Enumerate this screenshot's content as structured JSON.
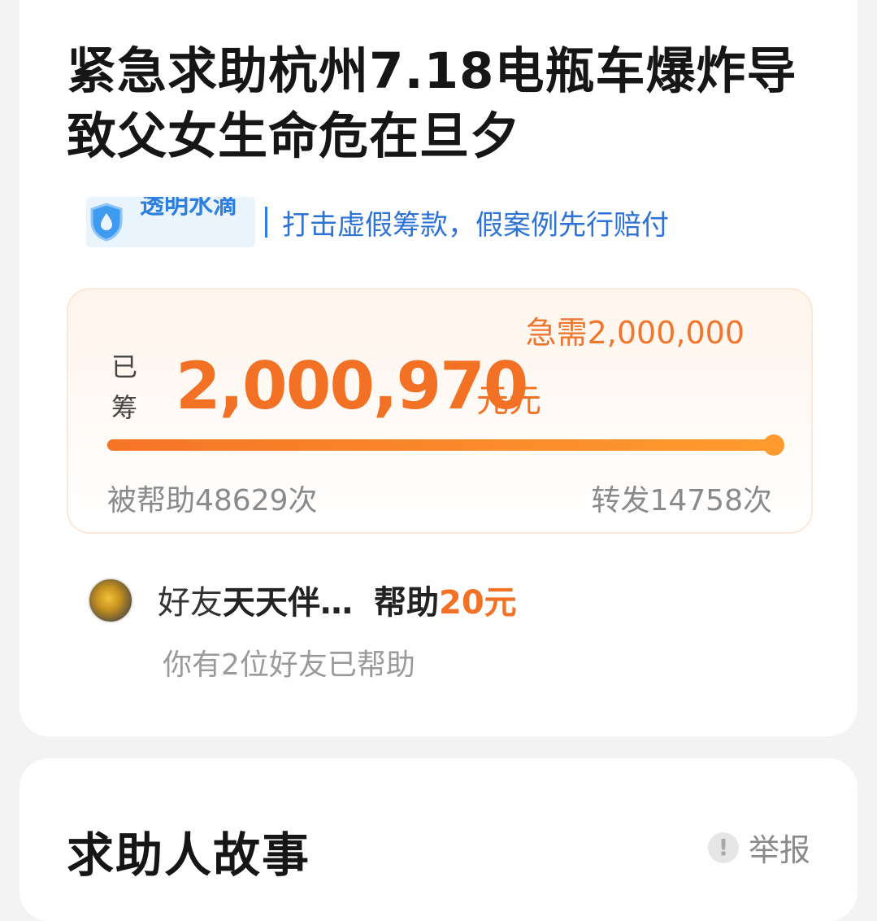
{
  "campaign": {
    "title": "紧急求助杭州7.18电瓶车爆炸导致父女生命危在旦夕"
  },
  "trust": {
    "badge_text": "透明水滴",
    "slogan": "打击虚假筹款，假案例先行赔付",
    "accent_color": "#2d73d6"
  },
  "funding": {
    "goal_text": "急需2,000,000",
    "raised_label": "已筹",
    "raised_amount": "2,000,970",
    "raised_unit": "元元",
    "progress_fraction": 1.0,
    "helped_text": "被帮助48629次",
    "shared_text": "转发14758次",
    "accent_color": "#f27124"
  },
  "friend_help": {
    "prefix": "好友",
    "name": "天天伴…",
    "action": "帮助",
    "amount": "20元",
    "subtext": "你有2位好友已帮助"
  },
  "story": {
    "title": "求助人故事",
    "report_icon": "exclamation-icon",
    "report_label": "举报"
  }
}
